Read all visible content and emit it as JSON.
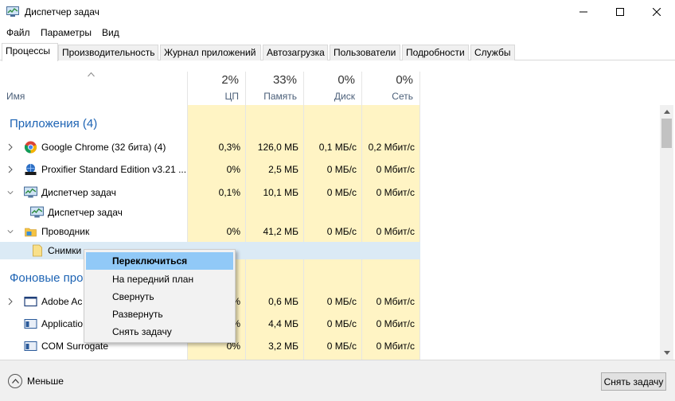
{
  "window": {
    "title": "Диспетчер задач"
  },
  "menu": [
    "Файл",
    "Параметры",
    "Вид"
  ],
  "tabs": [
    "Процессы",
    "Производительность",
    "Журнал приложений",
    "Автозагрузка",
    "Пользователи",
    "Подробности",
    "Службы"
  ],
  "columns": {
    "name": "Имя",
    "cpu": {
      "pct": "2%",
      "label": "ЦП"
    },
    "mem": {
      "pct": "33%",
      "label": "Память"
    },
    "disk": {
      "pct": "0%",
      "label": "Диск"
    },
    "net": {
      "pct": "0%",
      "label": "Сеть"
    }
  },
  "sections": {
    "apps": "Приложения (4)",
    "background": "Фоновые про"
  },
  "rows": [
    {
      "name": "Google Chrome (32 бита) (4)",
      "cpu": "0,3%",
      "mem": "126,0 МБ",
      "disk": "0,1 МБ/с",
      "net": "0,2 Мбит/с",
      "icon": "chrome-icon"
    },
    {
      "name": "Proxifier Standard Edition v3.21 ...",
      "cpu": "0%",
      "mem": "2,5 МБ",
      "disk": "0 МБ/с",
      "net": "0 Мбит/с",
      "icon": "proxifier-icon"
    },
    {
      "name": "Диспетчер задач",
      "cpu": "0,1%",
      "mem": "10,1 МБ",
      "disk": "0 МБ/с",
      "net": "0 Мбит/с",
      "icon": "task-manager-icon"
    },
    {
      "name": "Диспетчер задач",
      "icon": "task-manager-icon"
    },
    {
      "name": "Проводник",
      "cpu": "0%",
      "mem": "41,2 МБ",
      "disk": "0 МБ/с",
      "net": "0 Мбит/с",
      "icon": "explorer-icon"
    },
    {
      "name": "Снимки",
      "icon": "folder-icon"
    },
    {
      "name": "Adobe Ac",
      "cpu": "%",
      "mem": "0,6 МБ",
      "disk": "0 МБ/с",
      "net": "0 Мбит/с",
      "icon": "app-window-icon"
    },
    {
      "name": "Applicatio",
      "cpu": "%",
      "mem": "4,4 МБ",
      "disk": "0 МБ/с",
      "net": "0 Мбит/с",
      "icon": "app-frame-icon"
    },
    {
      "name": "COM Surrogate",
      "cpu": "0%",
      "mem": "3,2 МБ",
      "disk": "0 МБ/с",
      "net": "0 Мбит/с",
      "icon": "app-frame-icon"
    }
  ],
  "context_menu": [
    "Переключиться",
    "На передний план",
    "Свернуть",
    "Развернуть",
    "Снять задачу"
  ],
  "footer": {
    "less": "Меньше",
    "end_task": "Снять задачу"
  },
  "colors": {
    "accent": "#1e64b4",
    "highlight_col": "#fff4c4",
    "menu_highlight": "#91c9f7",
    "selected_row": "#dbeaf5"
  }
}
